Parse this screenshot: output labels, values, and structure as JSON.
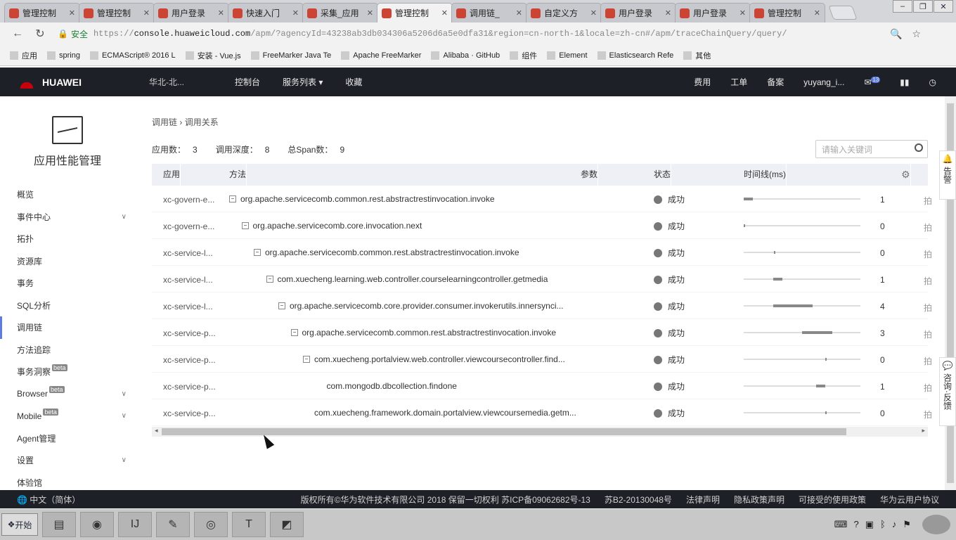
{
  "tabs": [
    {
      "title": "管理控制"
    },
    {
      "title": "管理控制"
    },
    {
      "title": "用户登录"
    },
    {
      "title": "快速入门"
    },
    {
      "title": "采集_应用"
    },
    {
      "title": "管理控制",
      "active": true
    },
    {
      "title": "调用链_"
    },
    {
      "title": "自定义方"
    },
    {
      "title": "用户登录"
    },
    {
      "title": "用户登录"
    },
    {
      "title": "管理控制"
    }
  ],
  "address": {
    "security": "安全",
    "url_scheme": "https://",
    "url_host": "console.huaweicloud.com",
    "url_path": "/apm/?agencyId=43238ab3db034306a5206d6a5e0dfa31&region=cn-north-1&locale=zh-cn#/apm/traceChainQuery/query/"
  },
  "bookmarks": [
    "应用",
    "spring",
    "ECMAScript® 2016 L",
    "安装 - Vue.js",
    "FreeMarker Java Te",
    "Apache FreeMarker",
    "Alibaba · GitHub",
    "组件",
    "Element",
    "Elasticsearch Refe",
    "其他"
  ],
  "topnav": {
    "brand": "HUAWEI",
    "region": "华北-北...",
    "console": "控制台",
    "services": "服务列表",
    "favorites": "收藏",
    "billing": "费用",
    "ticket": "工单",
    "filing": "备案",
    "user": "yuyang_i...",
    "msg_count": "13"
  },
  "sidebar": {
    "title": "应用性能管理",
    "items": [
      {
        "label": "概览"
      },
      {
        "label": "事件中心",
        "chev": "∨"
      },
      {
        "label": "拓扑"
      },
      {
        "label": "资源库"
      },
      {
        "label": "事务"
      },
      {
        "label": "SQL分析"
      },
      {
        "label": "调用链",
        "active": true
      },
      {
        "label": "方法追踪"
      },
      {
        "label": "事务洞察",
        "beta": "beta"
      },
      {
        "label": "Browser",
        "beta": "beta",
        "chev": "∨"
      },
      {
        "label": "Mobile",
        "beta": "beta",
        "chev": "∨"
      },
      {
        "label": "Agent管理"
      },
      {
        "label": "设置",
        "chev": "∨"
      },
      {
        "label": "体验馆"
      }
    ]
  },
  "breadcrumb": {
    "parent": "调用链",
    "sep": "›",
    "current": "调用关系"
  },
  "stats": {
    "app_label": "应用数：",
    "app_value": "3",
    "depth_label": "调用深度：",
    "depth_value": "8",
    "span_label": "总Span数：",
    "span_value": "9"
  },
  "search": {
    "placeholder": "请输入关键词"
  },
  "table": {
    "headers": {
      "app": "应用",
      "method": "方法",
      "params": "参数",
      "status": "状态",
      "timeline": "时间线(ms)"
    },
    "rows": [
      {
        "app": "xc-govern-e...",
        "method": "org.apache.servicecomb.common.rest.abstractrestinvocation.invoke",
        "indent": 0,
        "box": true,
        "status": "成功",
        "bar": [
          0,
          0.08
        ],
        "dur": "1"
      },
      {
        "app": "xc-govern-e...",
        "method": "org.apache.servicecomb.core.invocation.next",
        "indent": 1,
        "box": true,
        "status": "成功",
        "bar": [
          0,
          0.01
        ],
        "dur": "0"
      },
      {
        "app": "xc-service-l...",
        "method": "org.apache.servicecomb.common.rest.abstractrestinvocation.invoke",
        "indent": 2,
        "box": true,
        "status": "成功",
        "bar": [
          0.26,
          0.01
        ],
        "dur": "0"
      },
      {
        "app": "xc-service-l...",
        "method": "com.xuecheng.learning.web.controller.courselearningcontroller.getmedia",
        "indent": 3,
        "box": true,
        "status": "成功",
        "bar": [
          0.25,
          0.08
        ],
        "dur": "1"
      },
      {
        "app": "xc-service-l...",
        "method": "org.apache.servicecomb.core.provider.consumer.invokerutils.innersynci...",
        "indent": 4,
        "box": true,
        "status": "成功",
        "bar": [
          0.25,
          0.34
        ],
        "dur": "4"
      },
      {
        "app": "xc-service-p...",
        "method": "org.apache.servicecomb.common.rest.abstractrestinvocation.invoke",
        "indent": 5,
        "box": true,
        "status": "成功",
        "bar": [
          0.5,
          0.26
        ],
        "dur": "3"
      },
      {
        "app": "xc-service-p...",
        "method": "com.xuecheng.portalview.web.controller.viewcoursecontroller.find...",
        "indent": 6,
        "box": true,
        "status": "成功",
        "bar": [
          0.7,
          0.01
        ],
        "dur": "0"
      },
      {
        "app": "xc-service-p...",
        "method": "com.mongodb.dbcollection.findone",
        "indent": 7,
        "box": false,
        "status": "成功",
        "bar": [
          0.62,
          0.08
        ],
        "dur": "1"
      },
      {
        "app": "xc-service-p...",
        "method": "com.xuecheng.framework.domain.portalview.viewcoursemedia.getm...",
        "indent": 6,
        "box": false,
        "status": "成功",
        "bar": [
          0.7,
          0.01
        ],
        "dur": "0"
      }
    ]
  },
  "float": {
    "alarm": "告警",
    "consult": "咨询·反馈"
  },
  "footer": {
    "lang": "中文（简体）",
    "copyright": "版权所有©华为软件技术有限公司 2018 保留一切权利 苏ICP备09062682号-13",
    "icp2": "苏B2-20130048号",
    "legal": "法律声明",
    "privacy": "隐私政策声明",
    "aup": "可接受的使用政策",
    "agreement": "华为云用户协议"
  },
  "taskbar": {
    "start": "开始"
  },
  "colors": {
    "nav_bg": "#1d2026",
    "accent": "#5e7ce0",
    "brand_red": "#c7000b"
  }
}
